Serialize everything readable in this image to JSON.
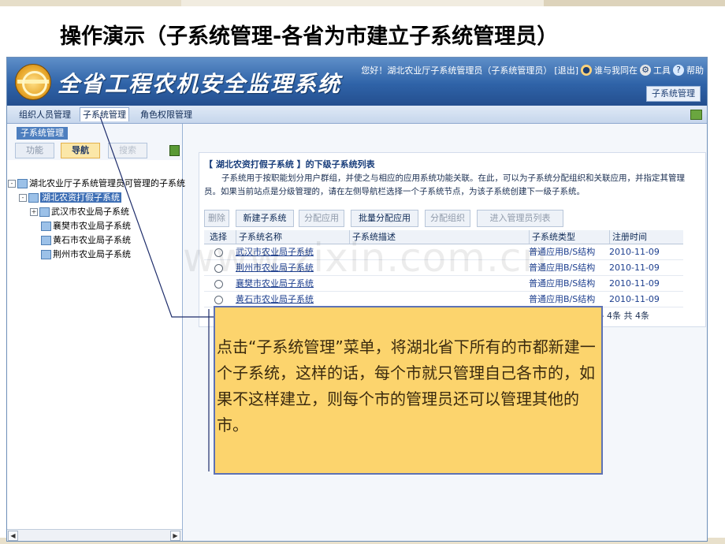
{
  "slide_title": "操作演示（子系统管理-各省为市建立子系统管理员）",
  "header": {
    "app_name": "全省工程农机安全监理系统",
    "greeting": "您好！湖北农业厅子系统管理员（子系统管理员）",
    "logout": "[退出]",
    "who_online": "谁与我同在",
    "tools": "工具",
    "help": "帮助",
    "current_subsystem": "子系统管理"
  },
  "menu": {
    "items": [
      "组织人员管理",
      "子系统管理",
      "角色权限管理"
    ],
    "active": "子系统管理"
  },
  "sidebar": {
    "title": "子系统管理",
    "tabs": [
      "功能",
      "导航",
      "搜索"
    ],
    "tree": {
      "root": "湖北农业厅子系统管理员可管理的子系统",
      "selected": "湖北农资打假子系统",
      "children": [
        "武汉市农业局子系统",
        "襄樊市农业局子系统",
        "黄石市农业局子系统",
        "荆州市农业局子系统"
      ]
    }
  },
  "panel": {
    "title": "【 湖北农资打假子系统 】的下级子系统列表",
    "description": "子系统用于按职能划分用户群组，并使之与相应的应用系统功能关联。在此，可以为子系统分配组织和关联应用，并指定其管理员。如果当前站点是分级管理的，请在左侧导航栏选择一个子系统节点，为该子系统创建下一级子系统。",
    "buttons": [
      "删除",
      "新建子系统",
      "分配应用",
      "批量分配应用",
      "分配组织",
      "进入管理员列表"
    ],
    "columns": [
      "选择",
      "子系统名称",
      "子系统描述",
      "子系统类型",
      "注册时间"
    ],
    "rows": [
      {
        "name": "武汉市农业局子系统",
        "desc": "",
        "type": "普通应用B/S结构",
        "date": "2010-11-09"
      },
      {
        "name": "荆州市农业局子系统",
        "desc": "",
        "type": "普通应用B/S结构",
        "date": "2010-11-09"
      },
      {
        "name": "襄樊市农业局子系统",
        "desc": "",
        "type": "普通应用B/S结构",
        "date": "2010-11-09"
      },
      {
        "name": "黄石市农业局子系统",
        "desc": "",
        "type": "普通应用B/S结构",
        "date": "2010-11-09"
      }
    ],
    "pager": "1 - 4条  共 4条"
  },
  "callout": {
    "text": "点击“子系统管理”菜单，将湖北省下所有的市都新建一个子系统，这样的话，每个市就只管理自己各市的，如果不这样建立，则每个市的管理员还可以管理其他的市。"
  },
  "watermark": "www.zixin.com.cn",
  "colors": {
    "header_blue": "#2f63a8",
    "callout_bg": "#fcd46d",
    "callout_border": "#5d72b5",
    "selected_node": "#3e6fb5",
    "link": "#1d3f8f"
  }
}
